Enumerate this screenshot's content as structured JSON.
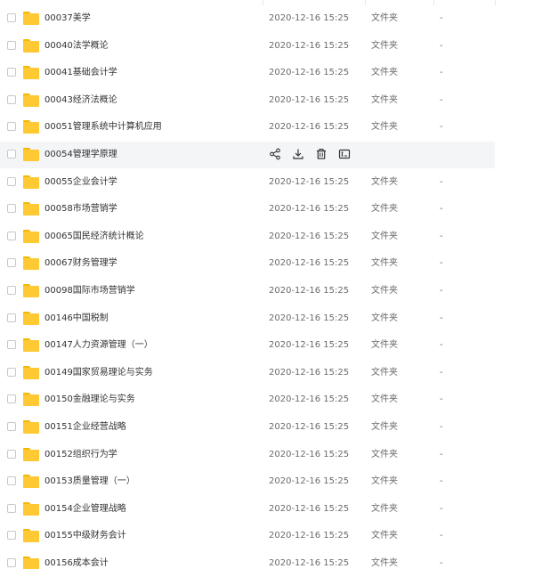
{
  "rows": [
    {
      "name": "00037美学",
      "date": "2020-12-16 15:25",
      "type": "文件夹",
      "size": "-"
    },
    {
      "name": "00040法学概论",
      "date": "2020-12-16 15:25",
      "type": "文件夹",
      "size": "-"
    },
    {
      "name": "00041基础会计学",
      "date": "2020-12-16 15:25",
      "type": "文件夹",
      "size": "-"
    },
    {
      "name": "00043经济法概论",
      "date": "2020-12-16 15:25",
      "type": "文件夹",
      "size": "-"
    },
    {
      "name": "00051管理系统中计算机应用",
      "date": "2020-12-16 15:25",
      "type": "文件夹",
      "size": "-"
    },
    {
      "name": "00054管理学原理",
      "date": "",
      "type": "",
      "size": ""
    },
    {
      "name": "00055企业会计学",
      "date": "2020-12-16 15:25",
      "type": "文件夹",
      "size": "-"
    },
    {
      "name": "00058市场营销学",
      "date": "2020-12-16 15:25",
      "type": "文件夹",
      "size": "-"
    },
    {
      "name": "00065国民经济统计概论",
      "date": "2020-12-16 15:25",
      "type": "文件夹",
      "size": "-"
    },
    {
      "name": "00067财务管理学",
      "date": "2020-12-16 15:25",
      "type": "文件夹",
      "size": "-"
    },
    {
      "name": "00098国际市场营销学",
      "date": "2020-12-16 15:25",
      "type": "文件夹",
      "size": "-"
    },
    {
      "name": "00146中国税制",
      "date": "2020-12-16 15:25",
      "type": "文件夹",
      "size": "-"
    },
    {
      "name": "00147人力资源管理（一）",
      "date": "2020-12-16 15:25",
      "type": "文件夹",
      "size": "-"
    },
    {
      "name": "00149国家贸易理论与实务",
      "date": "2020-12-16 15:25",
      "type": "文件夹",
      "size": "-"
    },
    {
      "name": "00150金融理论与实务",
      "date": "2020-12-16 15:25",
      "type": "文件夹",
      "size": "-"
    },
    {
      "name": "00151企业经营战略",
      "date": "2020-12-16 15:25",
      "type": "文件夹",
      "size": "-"
    },
    {
      "name": "00152组织行为学",
      "date": "2020-12-16 15:25",
      "type": "文件夹",
      "size": "-"
    },
    {
      "name": "00153质量管理（一）",
      "date": "2020-12-16 15:25",
      "type": "文件夹",
      "size": "-"
    },
    {
      "name": "00154企业管理战略",
      "date": "2020-12-16 15:25",
      "type": "文件夹",
      "size": "-"
    },
    {
      "name": "00155中级财务会计",
      "date": "2020-12-16 15:25",
      "type": "文件夹",
      "size": "-"
    },
    {
      "name": "00156成本会计",
      "date": "2020-12-16 15:25",
      "type": "文件夹",
      "size": "-"
    }
  ],
  "hover_actions": [
    "share-icon",
    "download-icon",
    "delete-icon",
    "rename-icon"
  ],
  "colors": {
    "folder": "#ffc933",
    "folder_tab": "#f5b800",
    "hover_bg": "#f4f5f7",
    "text": "#333333",
    "meta_text": "#6b6b6b"
  }
}
